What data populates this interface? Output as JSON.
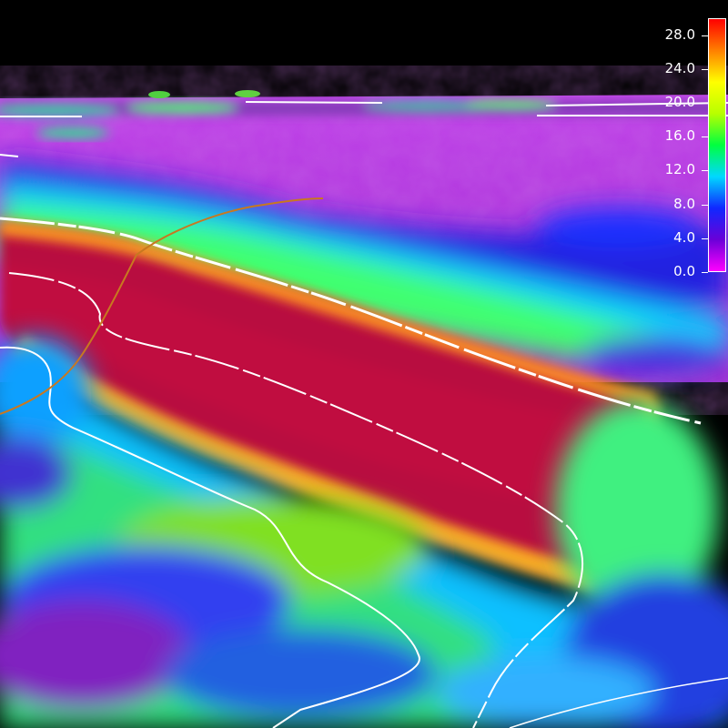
{
  "colorbar": {
    "ticks": [
      "28.0",
      "24.0",
      "20.0",
      "16.0",
      "12.0",
      "8.0",
      "4.0",
      "0.0"
    ],
    "min": 0.0,
    "max": 30.0,
    "colors": [
      "#ff00ff",
      "#6a00d8",
      "#1028ff",
      "#00d8ff",
      "#00ff40",
      "#b8ff00",
      "#ffff00",
      "#ff8000",
      "#ff0000"
    ]
  },
  "scene": {
    "sky_color": "#000000",
    "seafloor_base_color": "#a030c8",
    "slope_color": "#b0103c",
    "contour_color": "#ffffff",
    "track_line_color": "#c87820"
  }
}
